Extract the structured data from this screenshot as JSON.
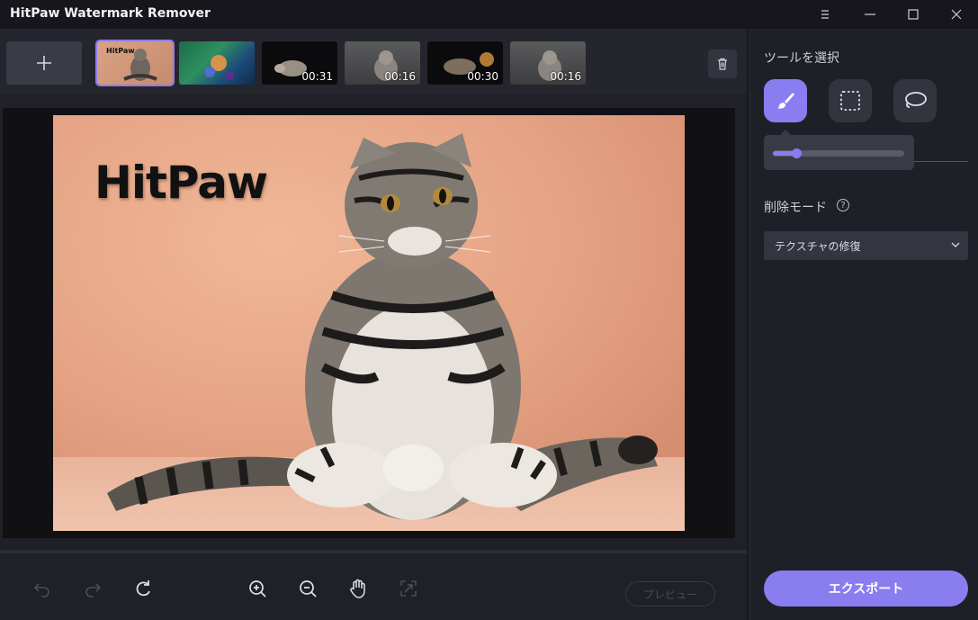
{
  "app": {
    "title": "HitPaw Watermark Remover"
  },
  "window_controls": [
    "menu-icon",
    "minimize-icon",
    "maximize-icon",
    "close-icon"
  ],
  "thumbnails": [
    {
      "label": "HitPaw",
      "duration": "",
      "selected": true
    },
    {
      "label": "",
      "duration": "",
      "selected": false
    },
    {
      "label": "",
      "duration": "00:31",
      "selected": false
    },
    {
      "label": "",
      "duration": "00:16",
      "selected": false
    },
    {
      "label": "",
      "duration": "00:30",
      "selected": false
    },
    {
      "label": "",
      "duration": "00:16",
      "selected": false
    }
  ],
  "canvas": {
    "watermark_text": "HitPaw"
  },
  "toolbar": {
    "icons": [
      "undo-icon",
      "redo-icon",
      "reset-icon",
      "zoom-in-icon",
      "zoom-out-icon",
      "hand-icon",
      "fit-icon"
    ],
    "preview_label": "プレビュー"
  },
  "panel": {
    "tools_label": "ツールを選択",
    "tools": [
      "brush-icon",
      "rectangle-select-icon",
      "lasso-icon"
    ],
    "active_tool": "brush-icon",
    "brush_size_fraction": 0.18,
    "removal_mode_label": "削除モード",
    "removal_mode_value": "テクスチャの修復",
    "export_label": "エクスポート"
  },
  "colors": {
    "accent": "#8a7df0",
    "background": "#1b1b22",
    "panel": "#1f1f27"
  }
}
